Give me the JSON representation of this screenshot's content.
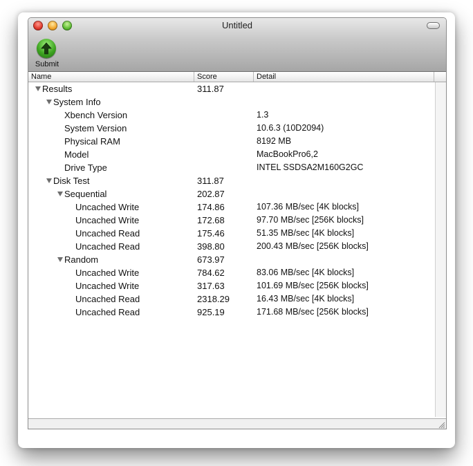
{
  "window": {
    "title": "Untitled"
  },
  "toolbar": {
    "submit_label": "Submit"
  },
  "table": {
    "columns": [
      "Name",
      "Score",
      "Detail"
    ],
    "rows": [
      {
        "name": "Results",
        "score": "311.87",
        "detail": ""
      },
      {
        "name": "System Info",
        "score": "",
        "detail": ""
      },
      {
        "name": "Xbench Version",
        "score": "",
        "detail": "1.3"
      },
      {
        "name": "System Version",
        "score": "",
        "detail": "10.6.3 (10D2094)"
      },
      {
        "name": "Physical RAM",
        "score": "",
        "detail": "8192 MB"
      },
      {
        "name": "Model",
        "score": "",
        "detail": "MacBookPro6,2"
      },
      {
        "name": "Drive Type",
        "score": "",
        "detail": "INTEL SSDSA2M160G2GC"
      },
      {
        "name": "Disk Test",
        "score": "311.87",
        "detail": ""
      },
      {
        "name": "Sequential",
        "score": "202.87",
        "detail": ""
      },
      {
        "name": "Uncached Write",
        "score": "174.86",
        "detail": "107.36 MB/sec [4K blocks]"
      },
      {
        "name": "Uncached Write",
        "score": "172.68",
        "detail": "97.70 MB/sec [256K blocks]"
      },
      {
        "name": "Uncached Read",
        "score": "175.46",
        "detail": "51.35 MB/sec [4K blocks]"
      },
      {
        "name": "Uncached Read",
        "score": "398.80",
        "detail": "200.43 MB/sec [256K blocks]"
      },
      {
        "name": "Random",
        "score": "673.97",
        "detail": ""
      },
      {
        "name": "Uncached Write",
        "score": "784.62",
        "detail": "83.06 MB/sec [4K blocks]"
      },
      {
        "name": "Uncached Write",
        "score": "317.63",
        "detail": "101.69 MB/sec [256K blocks]"
      },
      {
        "name": "Uncached Read",
        "score": "2318.29",
        "detail": "16.43 MB/sec [4K blocks]"
      },
      {
        "name": "Uncached Read",
        "score": "925.19",
        "detail": "171.68 MB/sec [256K blocks]"
      }
    ]
  }
}
